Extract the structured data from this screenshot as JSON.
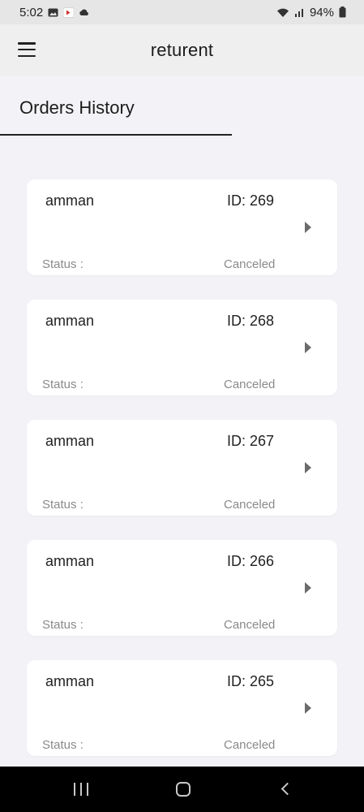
{
  "status_bar": {
    "time": "5:02",
    "battery": "94%",
    "left_icons": [
      "image-icon",
      "app-notification-icon",
      "cloud-icon"
    ],
    "right_icons": [
      "wifi-icon",
      "signal-icon",
      "battery-icon"
    ]
  },
  "app_bar": {
    "title": "returent",
    "menu_icon": "hamburger-menu-icon"
  },
  "section": {
    "title": "Orders History"
  },
  "orders": [
    {
      "city": "amman",
      "id_text": "ID: 269",
      "status_label": "Status :",
      "status_value": "Canceled"
    },
    {
      "city": "amman",
      "id_text": "ID: 268",
      "status_label": "Status :",
      "status_value": "Canceled"
    },
    {
      "city": "amman",
      "id_text": "ID: 267",
      "status_label": "Status :",
      "status_value": "Canceled"
    },
    {
      "city": "amman",
      "id_text": "ID: 266",
      "status_label": "Status :",
      "status_value": "Canceled"
    },
    {
      "city": "amman",
      "id_text": "ID: 265",
      "status_label": "Status :",
      "status_value": "Canceled"
    }
  ],
  "nav_bar": {
    "icons": [
      "recents-icon",
      "home-icon",
      "back-icon"
    ]
  },
  "colors": {
    "background": "#f3f2f6",
    "card": "#ffffff",
    "status_text": "#8a8a8a",
    "nav_bar": "#000000"
  }
}
